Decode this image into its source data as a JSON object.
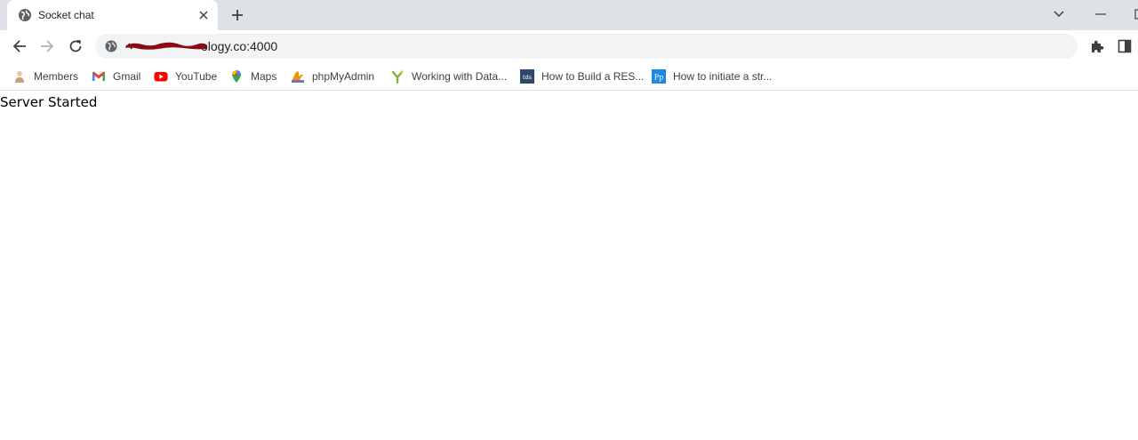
{
  "tab": {
    "title": "Socket chat",
    "favicon": "globe-icon"
  },
  "toolbar": {
    "url_visible": "ology.co:4000",
    "url_redacted": true
  },
  "bookmarks": [
    {
      "label": "Members",
      "icon": "members-icon"
    },
    {
      "label": "Gmail",
      "icon": "gmail-icon"
    },
    {
      "label": "YouTube",
      "icon": "youtube-icon"
    },
    {
      "label": "Maps",
      "icon": "maps-icon"
    },
    {
      "label": "phpMyAdmin",
      "icon": "phpmyadmin-icon"
    },
    {
      "label": "Working with Data...",
      "icon": "y-leaf-icon"
    },
    {
      "label": "How to Build a RES...",
      "icon": "tds-icon"
    },
    {
      "label": "How to initiate a str...",
      "icon": "pp-icon"
    }
  ],
  "page": {
    "text": "Server Started"
  },
  "colors": {
    "tabstrip_bg": "#dee1e6",
    "omnibox_bg": "#f1f3f4",
    "redaction": "#8b0a14",
    "youtube_red": "#ff0000",
    "tds_blue": "#2c4a6e",
    "pp_blue": "#1e88e5"
  }
}
